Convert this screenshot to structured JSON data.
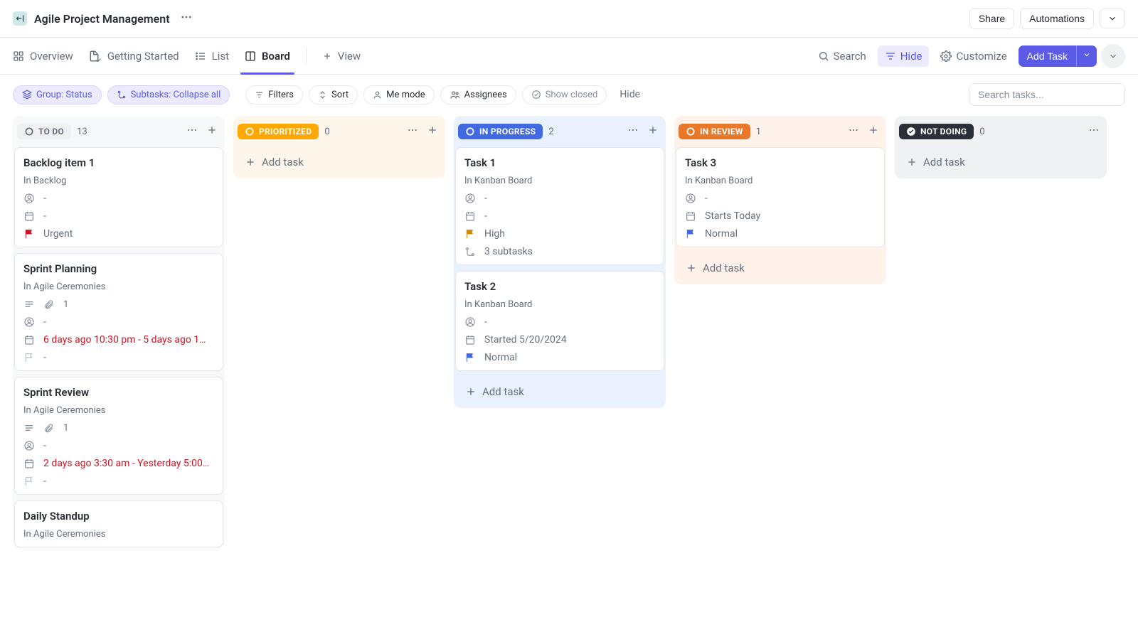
{
  "header": {
    "title": "Agile Project Management",
    "share": "Share",
    "automations": "Automations"
  },
  "views": {
    "overview": "Overview",
    "getting_started": "Getting Started",
    "list": "List",
    "board": "Board",
    "view": "View",
    "search": "Search",
    "hide": "Hide",
    "customize": "Customize",
    "add_task": "Add Task"
  },
  "filters": {
    "group": "Group: Status",
    "subtasks": "Subtasks: Collapse all",
    "filters": "Filters",
    "sort": "Sort",
    "me_mode": "Me mode",
    "assignees": "Assignees",
    "show_closed": "Show closed",
    "hide": "Hide",
    "search_placeholder": "Search tasks..."
  },
  "board": {
    "add_task_label": "Add task",
    "columns": [
      {
        "key": "todo",
        "label": "TO DO",
        "count": "13",
        "chip_class": "status-todo",
        "col_class": "c-todo",
        "cards": [
          {
            "title": "Backlog item 1",
            "sub": "In Backlog",
            "assignee": "-",
            "date": "-",
            "date_overdue": false,
            "flag": "urgent",
            "flag_label": "Urgent"
          },
          {
            "title": "Sprint Planning",
            "sub": "In Agile Ceremonies",
            "attachments": "1",
            "assignee": "-",
            "date": "6 days ago 10:30 pm - 5 days ago 1…",
            "date_overdue": true,
            "flag": "empty",
            "flag_label": "-"
          },
          {
            "title": "Sprint Review",
            "sub": "In Agile Ceremonies",
            "attachments": "1",
            "assignee": "-",
            "date": "2 days ago 3:30 am - Yesterday 5:00…",
            "date_overdue": true,
            "flag": "empty",
            "flag_label": "-"
          },
          {
            "title": "Daily Standup",
            "sub": "In Agile Ceremonies"
          }
        ]
      },
      {
        "key": "prioritized",
        "label": "PRIORITIZED",
        "count": "0",
        "chip_class": "status-prioritized",
        "col_class": "c-prioritized",
        "cards": []
      },
      {
        "key": "inprogress",
        "label": "IN PROGRESS",
        "count": "2",
        "chip_class": "status-inprogress",
        "col_class": "c-inprogress",
        "cards": [
          {
            "title": "Task 1",
            "sub": "In Kanban Board",
            "assignee": "-",
            "date": "-",
            "date_overdue": false,
            "flag": "high",
            "flag_label": "High",
            "subtasks": "3 subtasks"
          },
          {
            "title": "Task 2",
            "sub": "In Kanban Board",
            "assignee": "-",
            "date": "Started 5/20/2024",
            "date_overdue": false,
            "flag": "normal",
            "flag_label": "Normal"
          }
        ]
      },
      {
        "key": "inreview",
        "label": "IN REVIEW",
        "count": "1",
        "chip_class": "status-inreview",
        "col_class": "c-inreview",
        "cards": [
          {
            "title": "Task 3",
            "sub": "In Kanban Board",
            "assignee": "-",
            "date": "Starts Today",
            "date_overdue": false,
            "flag": "normal",
            "flag_label": "Normal"
          }
        ]
      },
      {
        "key": "notdoing",
        "label": "NOT DOING",
        "count": "0",
        "chip_class": "status-notdoing",
        "col_class": "c-notdoing",
        "cards": []
      }
    ]
  }
}
